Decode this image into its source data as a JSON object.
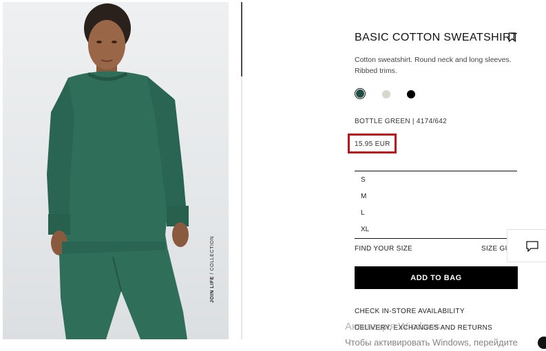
{
  "product": {
    "title": "BASIC COTTON SWEATSHIRT",
    "description": "Cotton sweatshirt. Round neck and long sleeves. Ribbed trims.",
    "color_code": "BOTTLE GREEN | 4174/642",
    "price": "15.95 EUR",
    "colors": [
      {
        "name": "bottle-green",
        "hex": "#1f4d44",
        "selected": true
      },
      {
        "name": "ecru",
        "hex": "#d9d6cc",
        "selected": false
      },
      {
        "name": "black",
        "hex": "#000000",
        "selected": false
      }
    ],
    "sizes": [
      "S",
      "M",
      "L",
      "XL"
    ]
  },
  "image": {
    "tag_bold": "JOIN LIFE",
    "tag_rest": " / COLLECTION"
  },
  "actions": {
    "find_size": "FIND YOUR SIZE",
    "size_guide": "SIZE GUIDE",
    "add_to_bag": "ADD TO BAG",
    "check_store": "CHECK IN-STORE AVAILABILITY",
    "delivery": "DELIVERY, EXCHANGES AND RETURNS"
  },
  "overlay": {
    "windows_line1": "Активация Windows",
    "windows_line2": "Чтобы активировать Windows, перейдите"
  },
  "colors": {
    "highlight": "#c0141b",
    "accent": "#000000"
  },
  "icons": {
    "bookmark": "bookmark-icon",
    "chat": "chat-icon"
  }
}
